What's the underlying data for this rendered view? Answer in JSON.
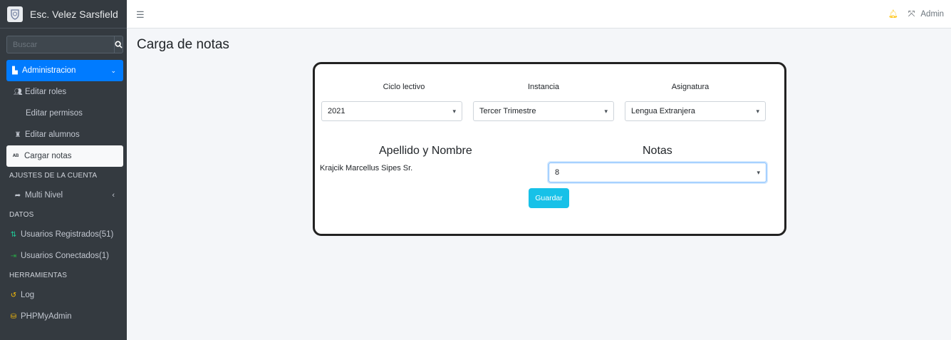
{
  "brand": {
    "name": "Esc. Velez Sarsfield"
  },
  "search": {
    "placeholder": "Buscar"
  },
  "sidebar": {
    "admin": {
      "label": "Administracion"
    },
    "items": [
      {
        "label": "Editar roles"
      },
      {
        "label": "Editar permisos"
      },
      {
        "label": "Editar alumnos"
      },
      {
        "label": "Cargar notas"
      }
    ],
    "header_account": "AJUSTES DE LA CUENTA",
    "multi_nivel": "Multi Nivel",
    "header_datos": "DATOS",
    "usuarios_registrados": "Usuarios Registrados(51)",
    "usuarios_conectados": "Usuarios Conectados(1)",
    "header_herramientas": "HERRAMIENTAS",
    "log": "Log",
    "phpmyadmin": "PHPMyAdmin"
  },
  "topbar": {
    "user": "Admin"
  },
  "page": {
    "title": "Carga de notas"
  },
  "form": {
    "ciclo_label": "Ciclo lectivo",
    "ciclo_value": "2021",
    "instancia_label": "Instancia",
    "instancia_value": "Tercer Trimestre",
    "asignatura_label": "Asignatura",
    "asignatura_value": "Lengua Extranjera",
    "apellido_label": "Apellido y Nombre",
    "notas_label": "Notas",
    "student_name": "Krajcik Marcellus Sipes Sr.",
    "nota_value": "8",
    "save_label": "Guardar"
  },
  "colors": {
    "sidebar": "#343a40",
    "accent": "#007bff",
    "button": "#17c1e8"
  }
}
